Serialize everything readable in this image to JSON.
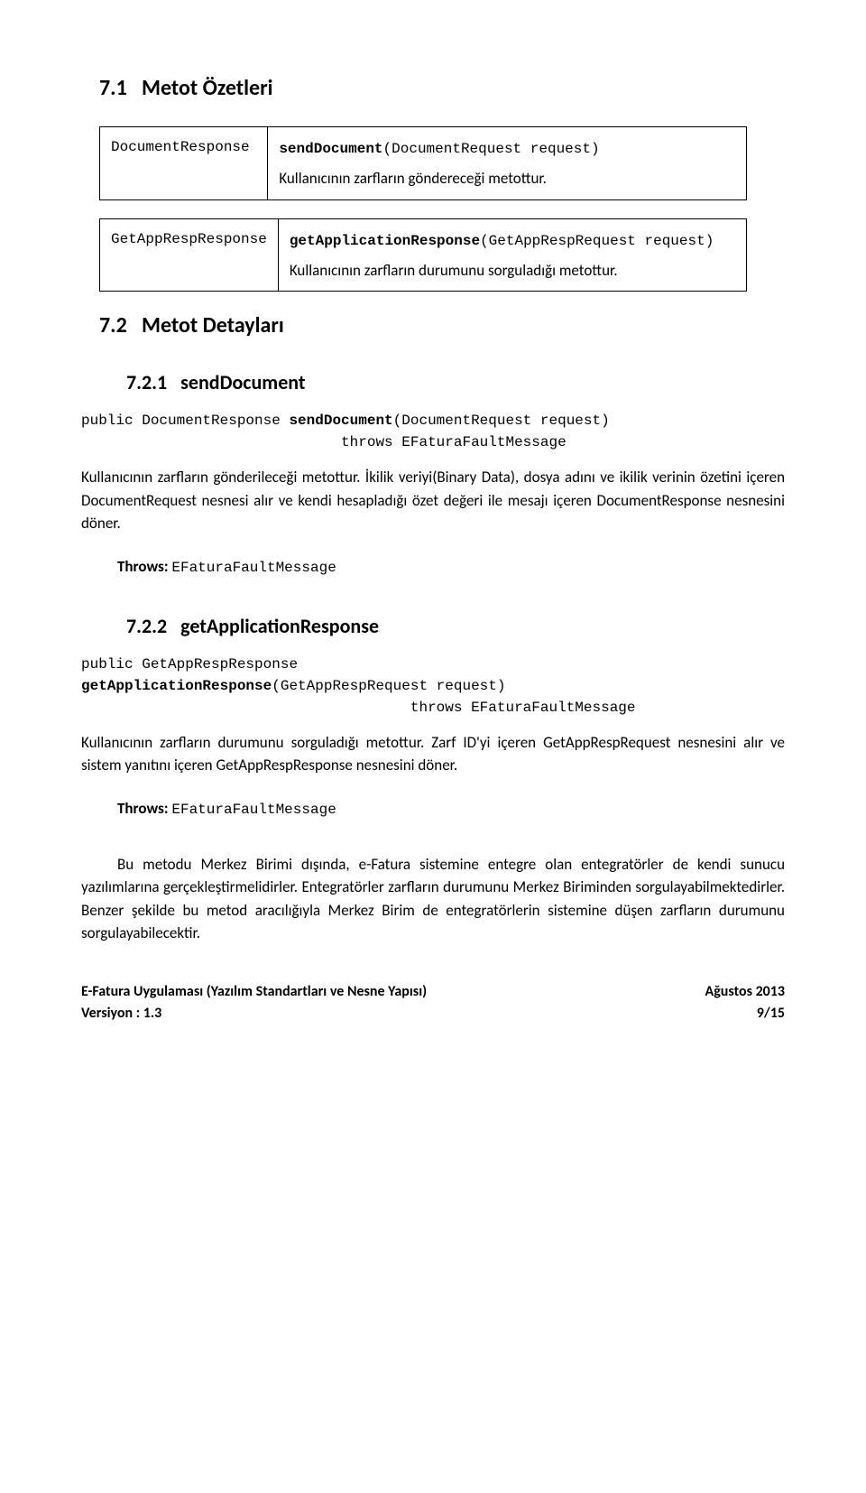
{
  "section71": {
    "number": "7.1",
    "title": "Metot Özetleri"
  },
  "table1": {
    "left": "DocumentResponse",
    "sig_bold": "sendDocument",
    "sig_rest": "(DocumentRequest request)",
    "desc": "Kullanıcının zarfların göndereceği metottur."
  },
  "table2": {
    "left": "GetAppRespResponse",
    "sig_bold": "getApplicationResponse",
    "sig_rest": "(GetAppRespRequest request)",
    "desc": "Kullanıcının zarfların durumunu sorguladığı metottur."
  },
  "section72": {
    "number": "7.2",
    "title": "Metot Detayları"
  },
  "section721": {
    "number": "7.2.1",
    "title": "sendDocument"
  },
  "code721": {
    "line1a": "public DocumentResponse ",
    "line1b": "sendDocument",
    "line1c": "(DocumentRequest request)",
    "line2": "                              throws EFaturaFaultMessage"
  },
  "para721": "Kullanıcının zarfların gönderileceği metottur. İkilik veriyi(Binary Data), dosya adını ve ikilik verinin özetini içeren DocumentRequest nesnesi alır ve kendi hesapladığı özet değeri ile mesajı içeren DocumentResponse nesnesini döner.",
  "throws721": {
    "label": "Throws: ",
    "value": "EFaturaFaultMessage"
  },
  "section722": {
    "number": "7.2.2",
    "title": "getApplicationResponse"
  },
  "code722": {
    "line1": "public GetAppRespResponse",
    "line2a": "getApplicationResponse",
    "line2b": "(GetAppRespRequest request)",
    "line3": "                                      throws EFaturaFaultMessage"
  },
  "para722a": "Kullanıcının zarfların durumunu sorguladığı metottur. Zarf ID'yi içeren GetAppRespRequest nesnesini alır ve sistem yanıtını içeren GetAppRespResponse nesnesini döner.",
  "throws722": {
    "label": "Throws: ",
    "value": "EFaturaFaultMessage"
  },
  "para722b": "Bu metodu Merkez Birimi dışında, e-Fatura sistemine entegre olan entegratörler de kendi sunucu yazılımlarına gerçekleştirmelidirler. Entegratörler zarfların durumunu Merkez Biriminden sorgulayabilmektedirler. Benzer şekilde bu metod aracılığıyla Merkez Birim de entegratörlerin sistemine düşen zarfların durumunu sorgulayabilecektir.",
  "footer": {
    "left1": "E-Fatura Uygulaması (Yazılım Standartları ve Nesne Yapısı)",
    "left2": "Versiyon : 1.3",
    "right1": "Ağustos 2013",
    "right2": "9/15"
  }
}
